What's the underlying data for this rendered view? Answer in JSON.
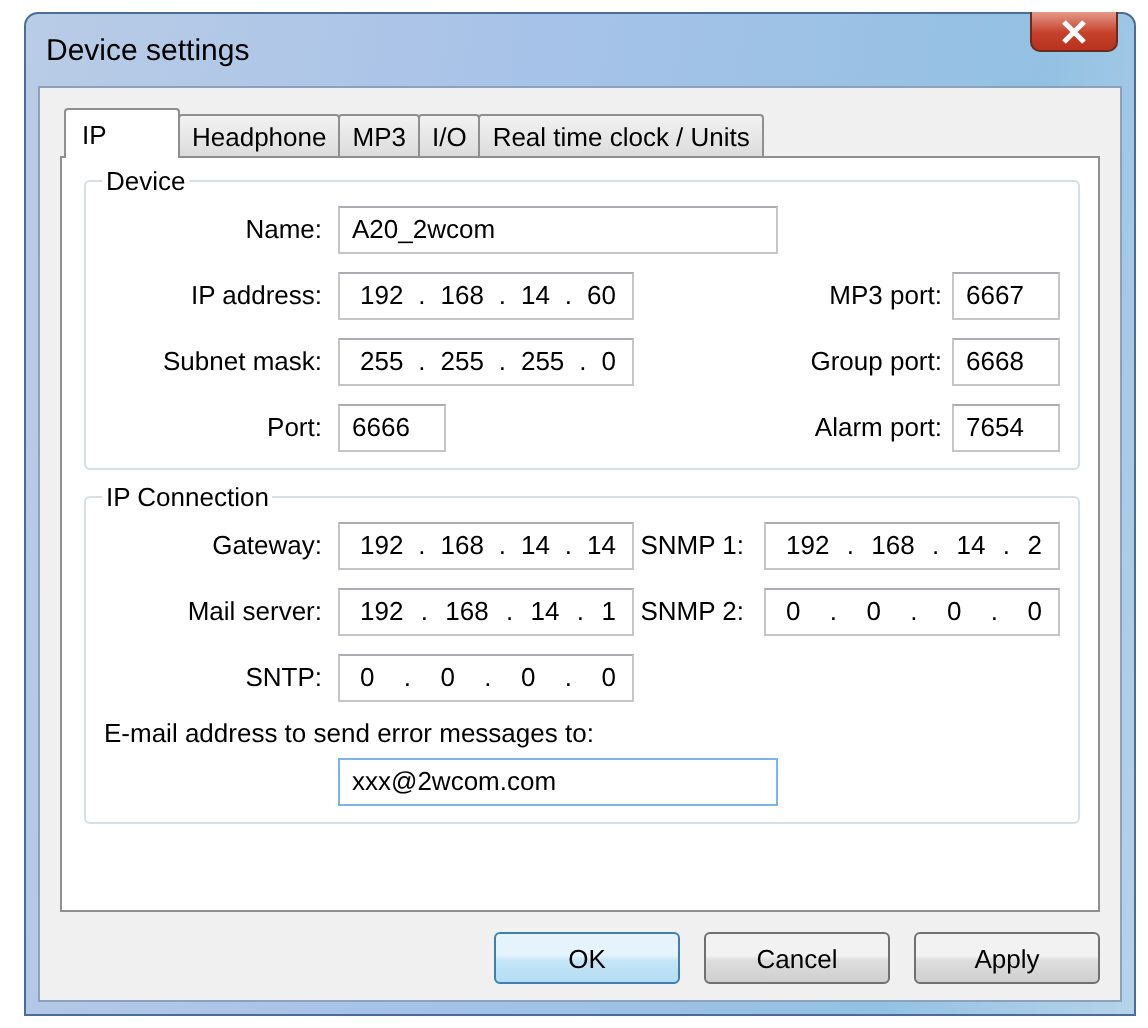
{
  "window": {
    "title": "Device settings"
  },
  "tabs": [
    {
      "label": "IP",
      "selected": true
    },
    {
      "label": "Headphone",
      "selected": false
    },
    {
      "label": "MP3",
      "selected": false
    },
    {
      "label": "I/O",
      "selected": false
    },
    {
      "label": "Real time clock / Units",
      "selected": false
    }
  ],
  "device": {
    "title": "Device",
    "rows": [
      {
        "left": {
          "label": "Name:",
          "value": "A20_2wcom",
          "kind": "wide"
        }
      },
      {
        "left": {
          "label": "IP address:",
          "value": "192 . 168 . 14 . 60",
          "kind": "ip"
        },
        "right": {
          "label": "MP3 port:",
          "value": "6667",
          "kind": "port"
        }
      },
      {
        "left": {
          "label": "Subnet mask:",
          "value": "255 . 255 . 255 . 0",
          "kind": "ip"
        },
        "right": {
          "label": "Group port:",
          "value": "6668",
          "kind": "port"
        }
      },
      {
        "left": {
          "label": "Port:",
          "value": "6666",
          "kind": "port"
        },
        "right": {
          "label": "Alarm port:",
          "value": "7654",
          "kind": "port"
        }
      }
    ]
  },
  "connection": {
    "title": "IP Connection",
    "rows": [
      {
        "left": {
          "label": "Gateway:",
          "value": "192 . 168 . 14 . 14",
          "kind": "ip"
        },
        "right": {
          "label": "SNMP 1:",
          "value": "192 . 168 . 14 . 2",
          "kind": "ip"
        }
      },
      {
        "left": {
          "label": "Mail server:",
          "value": "192 . 168 . 14 . 1",
          "kind": "ip"
        },
        "right": {
          "label": "SNMP 2:",
          "value": "0 . 0 . 0 . 0",
          "kind": "ip"
        }
      },
      {
        "left": {
          "label": "SNTP:",
          "value": "0 . 0 . 0 . 0",
          "kind": "ip"
        }
      }
    ],
    "email": {
      "label": "E-mail address to send error messages to:",
      "value": "xxx@2wcom.com",
      "focused": true
    }
  },
  "buttons": [
    {
      "label": "OK",
      "default": true
    },
    {
      "label": "Cancel",
      "default": false
    },
    {
      "label": "Apply",
      "default": false
    }
  ]
}
